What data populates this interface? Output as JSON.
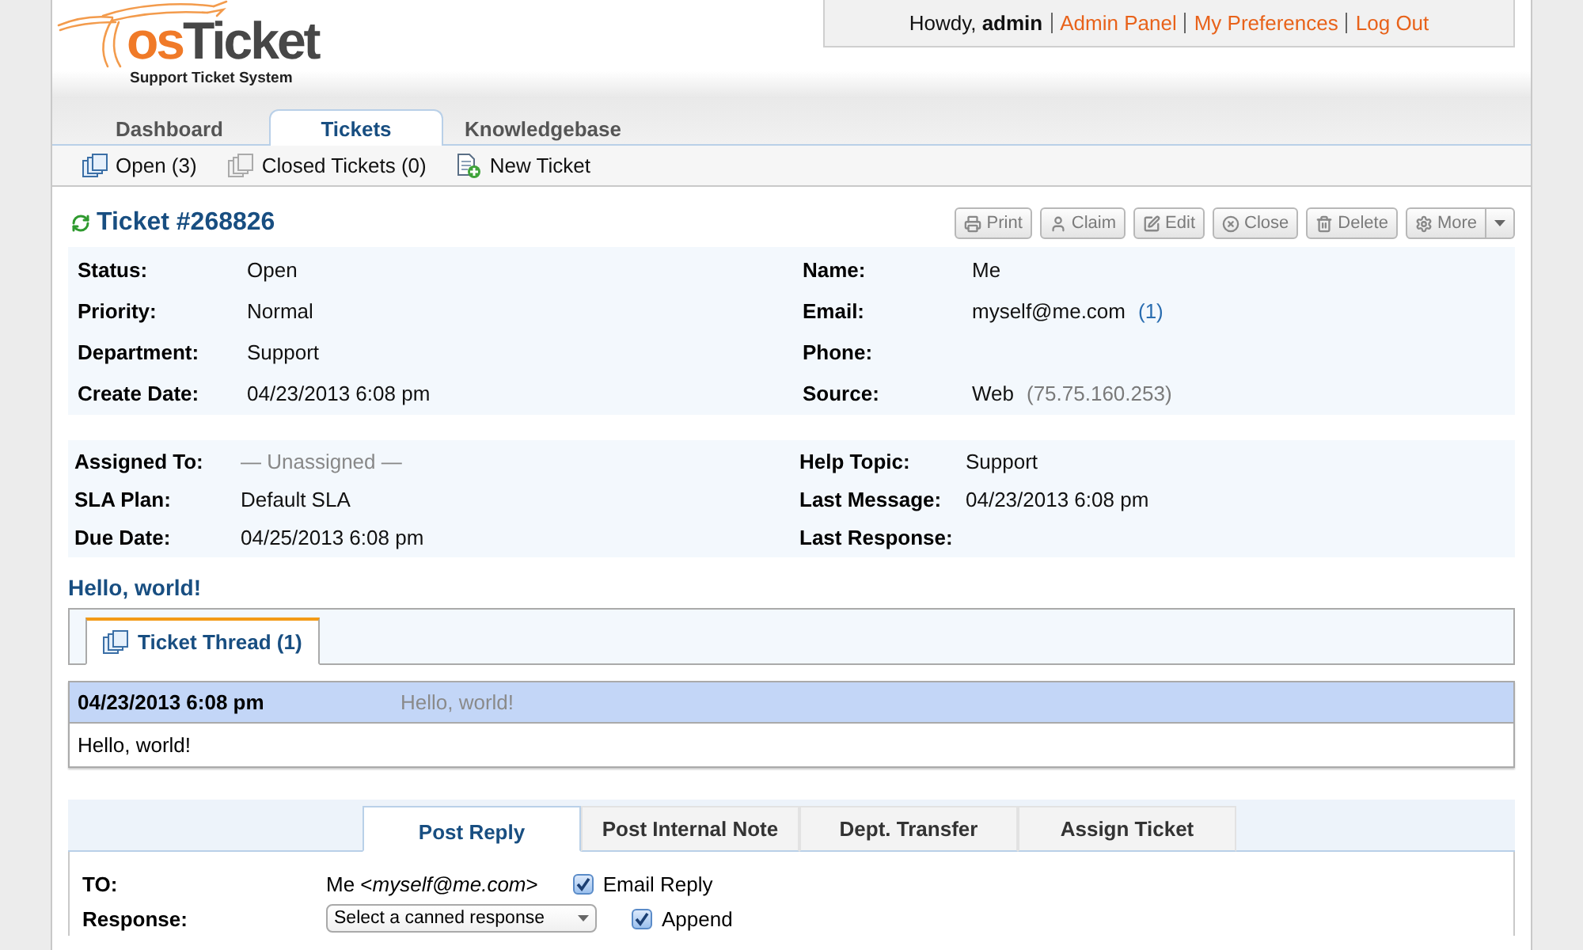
{
  "header": {
    "logo": {
      "parts": [
        {
          "text": "os",
          "color": "#f07a28"
        },
        {
          "text": "Ticket",
          "color": "#474747"
        }
      ],
      "tagline": "Support Ticket System"
    },
    "user_bar": {
      "greeting": "Howdy, **admin**",
      "links": [
        "Admin Panel",
        "My Preferences",
        "Log Out"
      ]
    }
  },
  "nav": {
    "tabs": [
      {
        "label": "Dashboard",
        "selected": false
      },
      {
        "label": "Tickets",
        "selected": true
      },
      {
        "label": "Knowledgebase",
        "selected": false
      }
    ]
  },
  "subnav": {
    "items": [
      {
        "kind": "open",
        "label": "Open (3)"
      },
      {
        "kind": "closed",
        "label": "Closed Tickets (0)"
      },
      {
        "kind": "new",
        "label": "New Ticket"
      }
    ]
  },
  "ticket": {
    "title": "Ticket #268826",
    "actions": [
      {
        "kind": "print",
        "label": "Print"
      },
      {
        "kind": "claim",
        "label": "Claim"
      },
      {
        "kind": "edit",
        "label": "Edit"
      },
      {
        "kind": "close",
        "label": "Close"
      },
      {
        "kind": "delete",
        "label": "Delete"
      },
      {
        "kind": "more",
        "label": "More"
      }
    ],
    "details": {
      "left": [
        {
          "label": "Status:",
          "value": "Open"
        },
        {
          "label": "Priority:",
          "value": "Normal"
        },
        {
          "label": "Department:",
          "value": "Support"
        },
        {
          "label": "Create Date:",
          "value": "04/23/2013 6:08 pm"
        }
      ],
      "right": [
        {
          "label": "Name:",
          "value": "Me"
        },
        {
          "label": "Email:",
          "value": "myself@me.com",
          "note": {
            "kind": "link",
            "text": "(1)"
          }
        },
        {
          "label": "Phone:"
        },
        {
          "label": "Source:",
          "value": "Web",
          "note": {
            "kind": "muted",
            "text": "(75.75.160.253)"
          }
        }
      ]
    },
    "assignment": {
      "left": [
        {
          "label": "Assigned To:",
          "value": "— Unassigned —",
          "muted": true
        },
        {
          "label": "SLA Plan:",
          "value": "Default SLA",
          "muted": false
        },
        {
          "label": "Due Date:",
          "value": "04/25/2013 6:08 pm",
          "muted": false
        }
      ],
      "right": [
        {
          "label": "Help Topic:",
          "value": "Support"
        },
        {
          "label": "Last Message:",
          "value": "04/23/2013 6:08 pm"
        },
        {
          "label": "Last Response:"
        }
      ]
    },
    "subject": "Hello, world!"
  },
  "thread": {
    "tabs": [
      {
        "label": "Ticket Thread (1)",
        "selected": true
      }
    ],
    "entries": [
      {
        "date": "04/23/2013 6:08 pm",
        "title": "Hello, world!",
        "body": "Hello, world!"
      }
    ]
  },
  "reply": {
    "tabs": [
      {
        "label": "Post Reply",
        "selected": true
      },
      {
        "label": "Post Internal Note",
        "selected": false
      },
      {
        "label": "Dept. Transfer",
        "selected": false
      },
      {
        "label": "Assign Ticket",
        "selected": false
      }
    ],
    "fields": [
      {
        "kind": "recipient",
        "label": "TO:",
        "value": "Me <*myself@me.com*>",
        "checkbox": {
          "label": "Email Reply",
          "checked": true
        }
      },
      {
        "kind": "select",
        "label": "Response:",
        "value": "Select a canned response",
        "checkbox": {
          "label": "Append",
          "checked": true
        }
      }
    ]
  }
}
